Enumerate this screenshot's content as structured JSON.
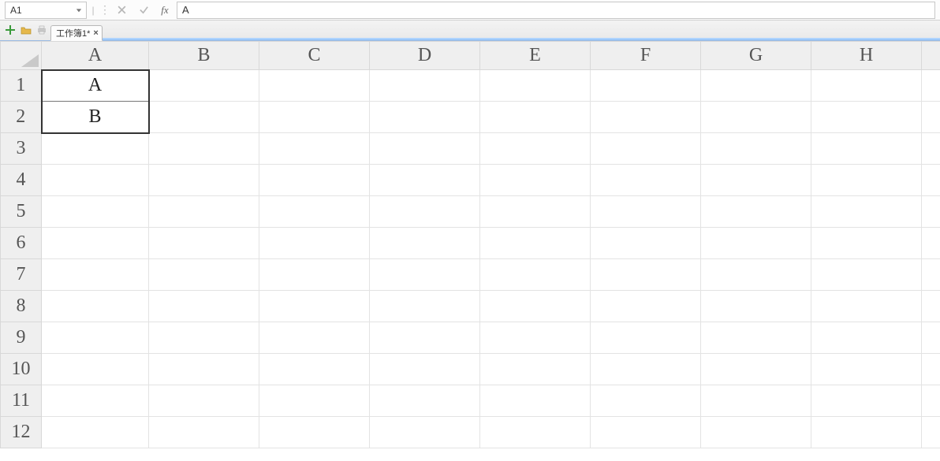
{
  "formula_bar": {
    "name_box": "A1",
    "fx_label": "fx",
    "formula_value": "A"
  },
  "tabstrip": {
    "workbook_tab_label": "工作簿1*"
  },
  "sheet": {
    "columns": [
      "A",
      "B",
      "C",
      "D",
      "E",
      "F",
      "G",
      "H"
    ],
    "rows": [
      "1",
      "2",
      "3",
      "4",
      "5",
      "6",
      "7",
      "8",
      "9",
      "10",
      "11",
      "12"
    ],
    "cells": {
      "A1": "A",
      "A2": "B"
    },
    "selection": [
      "A1",
      "A2"
    ],
    "active_cell": "A1"
  }
}
